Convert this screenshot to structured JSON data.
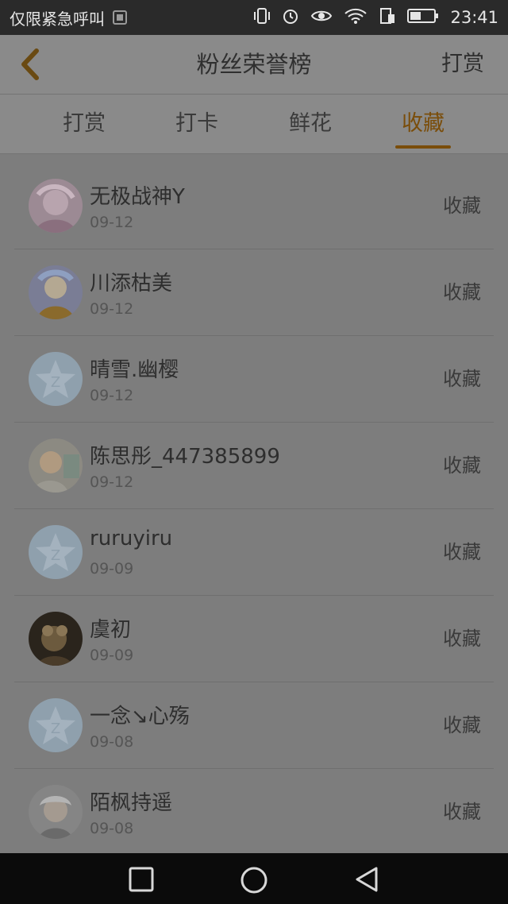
{
  "status_bar": {
    "carrier_text": "仅限紧急呼叫",
    "time": "23:41",
    "icons": [
      "notification-image-icon",
      "vibrate-icon",
      "alarm-icon",
      "eye-icon",
      "wifi-icon",
      "sim-icon",
      "battery-icon"
    ]
  },
  "header": {
    "title": "粉丝荣誉榜",
    "action_label": "打赏"
  },
  "tabs": [
    {
      "label": "打赏",
      "active": false
    },
    {
      "label": "打卡",
      "active": false
    },
    {
      "label": "鲜花",
      "active": false
    },
    {
      "label": "收藏",
      "active": true
    }
  ],
  "rows": [
    {
      "name": "无极战神Y",
      "date": "09-12",
      "action": "收藏",
      "avatar": "photo"
    },
    {
      "name": "川添枯美",
      "date": "09-12",
      "action": "收藏",
      "avatar": "photo"
    },
    {
      "name": "晴雪.幽樱",
      "date": "09-12",
      "action": "收藏",
      "avatar": "default"
    },
    {
      "name": "陈思彤_447385899",
      "date": "09-12",
      "action": "收藏",
      "avatar": "photo"
    },
    {
      "name": "ruruyiru",
      "date": "09-09",
      "action": "收藏",
      "avatar": "default"
    },
    {
      "name": "虞初",
      "date": "09-09",
      "action": "收藏",
      "avatar": "photo"
    },
    {
      "name": "一念↘心殇",
      "date": "09-08",
      "action": "收藏",
      "avatar": "default"
    },
    {
      "name": "陌枫持遥",
      "date": "09-08",
      "action": "收藏",
      "avatar": "photo"
    }
  ],
  "colors": {
    "accent": "#7a4d0a",
    "overlay_bg": "#7d7d7d",
    "status_bar": "#2a2a2a",
    "nav_bar": "#0b0b0b"
  },
  "nav_bar": {
    "buttons": [
      "recent-apps-square-icon",
      "home-circle-icon",
      "back-triangle-icon"
    ]
  }
}
